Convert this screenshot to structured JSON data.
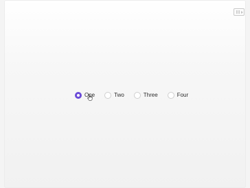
{
  "toolbar": {
    "video_icon": "video-camera-icon"
  },
  "radio_group": {
    "options": [
      {
        "label": "One",
        "checked": true
      },
      {
        "label": "Two",
        "checked": false
      },
      {
        "label": "Three",
        "checked": false
      },
      {
        "label": "Four",
        "checked": false
      }
    ]
  },
  "colors": {
    "accent": "#6b4bd8",
    "border": "#cfcfcf",
    "text": "#2b2b2b"
  }
}
